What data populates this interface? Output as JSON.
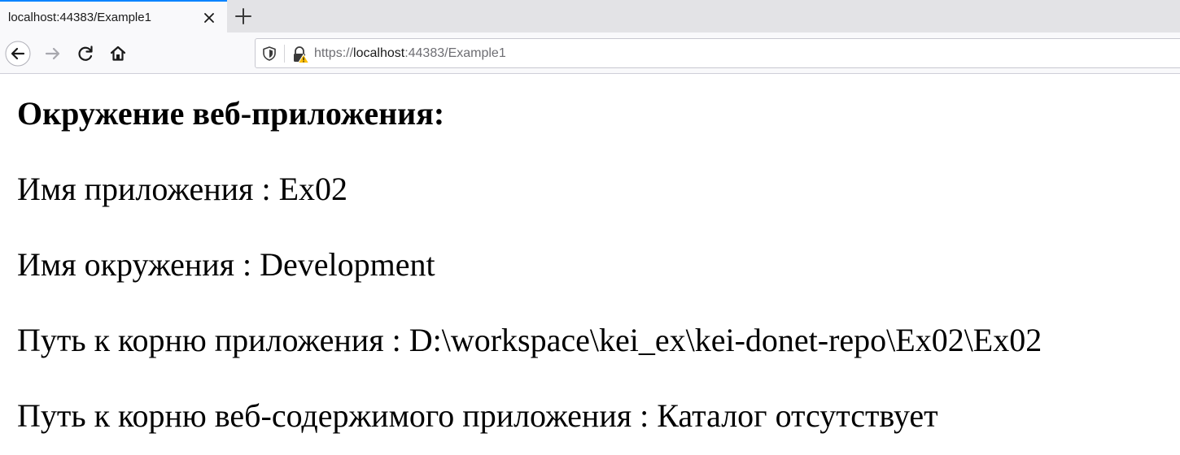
{
  "browser": {
    "tab": {
      "title": "localhost:44383/Example1"
    },
    "toolbar": {
      "url_scheme": "https://",
      "url_host": "localhost",
      "url_rest": ":44383/Example1"
    },
    "icons": {
      "tab_close": "close-icon",
      "new_tab": "plus-icon",
      "back": "back-arrow-icon",
      "forward": "forward-arrow-icon",
      "reload": "reload-icon",
      "home": "home-icon",
      "tracking": "shield-icon",
      "security": "warning-lock-icon"
    },
    "colors": {
      "tab_accent": "#0a84ff",
      "warning": "#ffbf00"
    }
  },
  "page": {
    "heading": "Окружение веб-приложения:",
    "lines": [
      "Имя приложения : Ex02",
      "Имя окружения : Development",
      "Путь к корню приложения : D:\\workspace\\kei_ex\\kei-donet-repo\\Ex02\\Ex02",
      "Путь к корню веб-содержимого приложения : Каталог отсутствует"
    ]
  }
}
